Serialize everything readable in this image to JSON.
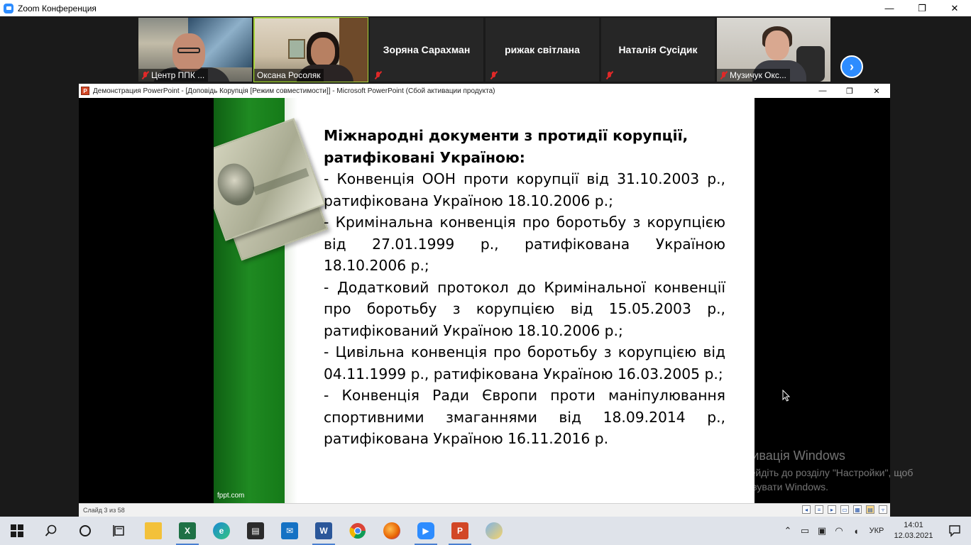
{
  "zoom": {
    "title": "Zoom Конференция",
    "window_controls": {
      "minimize": "—",
      "restore": "❐",
      "close": "✕"
    }
  },
  "gallery": {
    "participants": [
      {
        "name": "Центр ППК ...",
        "muted": true,
        "video": true
      },
      {
        "name": "Оксана Росоляк",
        "muted": false,
        "video": true,
        "active_speaker": true
      },
      {
        "name": "Зоряна Сарахман",
        "muted": true,
        "video": false
      },
      {
        "name": "рижак світлана",
        "muted": true,
        "video": false
      },
      {
        "name": "Наталія Сусідик",
        "muted": true,
        "video": false
      },
      {
        "name": "Музичук Окс...",
        "muted": true,
        "video": true
      }
    ],
    "next_icon": "›"
  },
  "ppt": {
    "title": "Демонстрация PowerPoint - [Доповідь Корупція [Режим совместимости]] - Microsoft PowerPoint (Сбой активации продукта)",
    "window_controls": {
      "minimize": "—",
      "restore": "❐",
      "close": "✕"
    },
    "status": {
      "slide_count": "Слайд 3 из 58"
    }
  },
  "slide": {
    "heading": "Міжнародні документи з протидії корупції, ратифіковані Україною:",
    "paragraphs": [
      "- Конвенція ООН проти корупції від 31.10.2003 р., ратифікована Україною 18.10.2006 р.;",
      " - Кримінальна конвенція про боротьбу з корупцією від 27.01.1999 р., ратифікована Україною 18.10.2006 р.;",
      " - Додатковий протокол до Кримінальної конвенції про боротьбу з корупцією від 15.05.2003 р., ратифікований Україною 18.10.2006 р.;",
      " - Цивільна конвенція про боротьбу з корупцією від 04.11.1999 р., ратифікована Україною 16.03.2005 р.;",
      " - Конвенція Ради Європи проти маніпулювання спортивними змаганнями від 18.09.2014 р., ратифікована Україною 16.11.2016 р."
    ],
    "footer": "fppt.com"
  },
  "activation": {
    "title": "Активація Windows",
    "line1": "Перейдіть до розділу \"Настройки\", щоб",
    "line2": "активувати Windows."
  },
  "taskbar": {
    "apps": [
      {
        "name": "start",
        "icon": "windows-icon"
      },
      {
        "name": "search",
        "icon": "search-icon"
      },
      {
        "name": "cortana",
        "icon": "cortana-icon"
      },
      {
        "name": "task-view",
        "icon": "task-view-icon"
      },
      {
        "name": "file-explorer",
        "icon": "folder-icon",
        "color": "#f3c13a"
      },
      {
        "name": "excel",
        "icon": "excel-icon",
        "color": "#1e7145"
      },
      {
        "name": "edge",
        "icon": "edge-icon",
        "color": "#1b8ad3"
      },
      {
        "name": "store",
        "icon": "store-icon",
        "color": "#2b2b2b"
      },
      {
        "name": "mail",
        "icon": "mail-icon",
        "color": "#1572c4"
      },
      {
        "name": "word",
        "icon": "word-icon",
        "color": "#2b579a"
      },
      {
        "name": "chrome",
        "icon": "chrome-icon"
      },
      {
        "name": "firefox",
        "icon": "firefox-icon",
        "color": "#e66000"
      },
      {
        "name": "zoom",
        "icon": "zoom-icon",
        "color": "#2d8cff"
      },
      {
        "name": "powerpoint",
        "icon": "powerpoint-icon",
        "color": "#d24726"
      },
      {
        "name": "paint",
        "icon": "paint-icon"
      }
    ],
    "language": "УКР",
    "time": "14:01",
    "date": "12.03.2021"
  }
}
